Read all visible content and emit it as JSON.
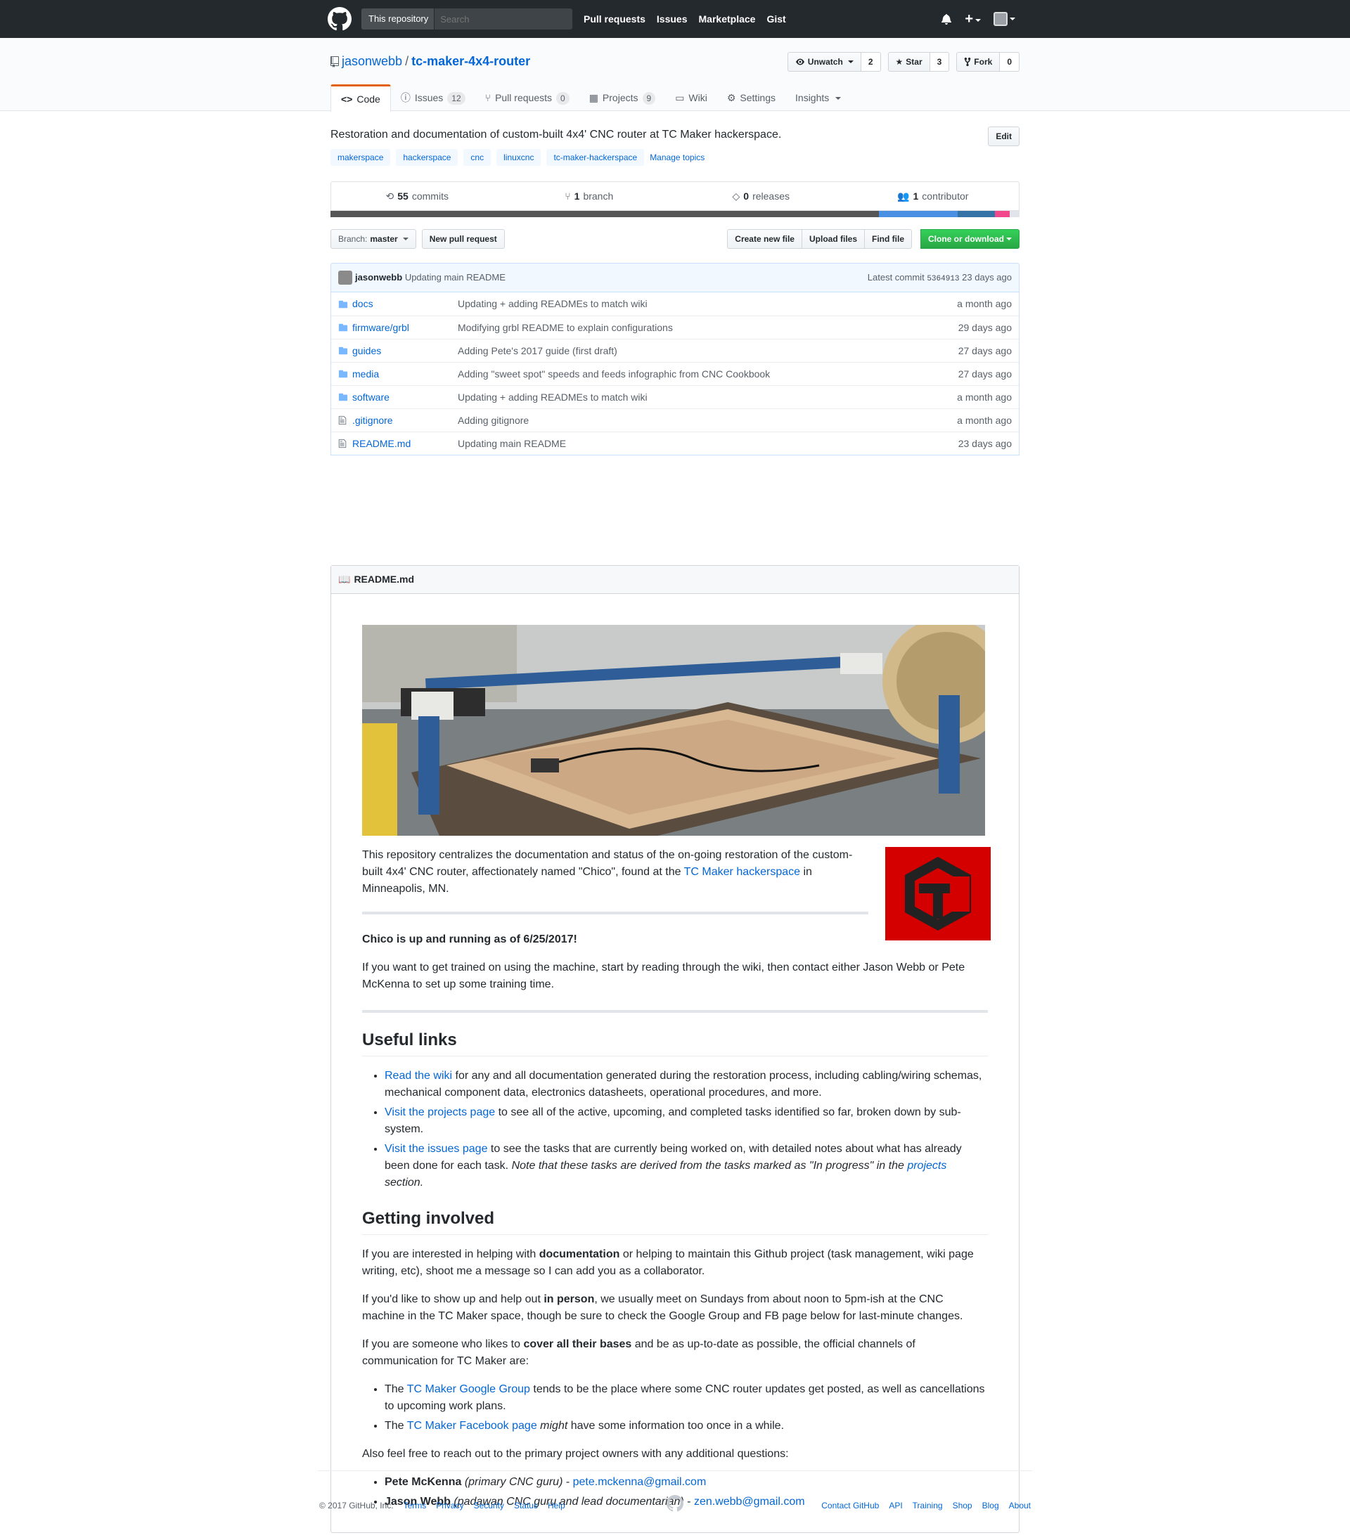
{
  "header": {
    "scope": "This repository",
    "search_placeholder": "Search",
    "nav": [
      "Pull requests",
      "Issues",
      "Marketplace",
      "Gist"
    ],
    "plus": "+"
  },
  "repo": {
    "owner": "jasonwebb",
    "separator": "/",
    "name": "tc-maker-4x4-router",
    "unwatch_label": "Unwatch",
    "watch_count": "2",
    "star_label": "Star",
    "star_count": "3",
    "fork_label": "Fork",
    "fork_count": "0"
  },
  "tabs": [
    {
      "label": "Code",
      "counter": ""
    },
    {
      "label": "Issues",
      "counter": "12"
    },
    {
      "label": "Pull requests",
      "counter": "0"
    },
    {
      "label": "Projects",
      "counter": "9"
    },
    {
      "label": "Wiki",
      "counter": ""
    },
    {
      "label": "Settings",
      "counter": ""
    },
    {
      "label": "Insights",
      "counter": ""
    }
  ],
  "description": "Restoration and documentation of custom-built 4x4' CNC router at TC Maker hackerspace.",
  "edit_label": "Edit",
  "topics": [
    "makerspace",
    "hackerspace",
    "cnc",
    "linuxcnc",
    "tc-maker-hackerspace"
  ],
  "manage_topics": "Manage topics",
  "summary": {
    "commits_num": "55",
    "commits_label": "commits",
    "branch_num": "1",
    "branch_label": "branch",
    "releases_num": "0",
    "releases_label": "releases",
    "contrib_num": "1",
    "contrib_label": "contributor"
  },
  "languages": [
    {
      "color": "#555555",
      "pct": 79.6
    },
    {
      "color": "#4a90e2",
      "pct": 11.4
    },
    {
      "color": "#3572A5",
      "pct": 5.4
    },
    {
      "color": "#f1478b",
      "pct": 2.2
    },
    {
      "color": "#e1e4e8",
      "pct": 1.4
    }
  ],
  "filenav": {
    "branch_prefix": "Branch:",
    "branch": "master",
    "new_pr": "New pull request",
    "create": "Create new file",
    "upload": "Upload files",
    "find": "Find file",
    "clone": "Clone or download"
  },
  "commit": {
    "author": "jasonwebb",
    "message": "Updating main README",
    "latest_label": "Latest commit",
    "sha": "5364913",
    "age": "23 days ago"
  },
  "files": [
    {
      "type": "dir",
      "name": "docs",
      "msg": "Updating + adding READMEs to match wiki",
      "age": "a month ago"
    },
    {
      "type": "dir",
      "name": "firmware/grbl",
      "msg": "Modifying grbl README to explain configurations",
      "age": "29 days ago"
    },
    {
      "type": "dir",
      "name": "guides",
      "msg": "Adding Pete's 2017 guide (first draft)",
      "age": "27 days ago"
    },
    {
      "type": "dir",
      "name": "media",
      "msg": "Adding \"sweet spot\" speeds and feeds infographic from CNC Cookbook",
      "age": "27 days ago"
    },
    {
      "type": "dir",
      "name": "software",
      "msg": "Updating + adding READMEs to match wiki",
      "age": "a month ago"
    },
    {
      "type": "file",
      "name": ".gitignore",
      "msg": "Adding gitignore",
      "age": "a month ago"
    },
    {
      "type": "file",
      "name": "README.md",
      "msg": "Updating main README",
      "age": "23 days ago"
    }
  ],
  "readme": {
    "title": "README.md",
    "intro_a": "This repository centralizes the documentation and status of the on-going restoration of the custom-built 4x4' CNC router, affectionately named \"Chico\", found at the ",
    "intro_link": "TC Maker hackerspace",
    "intro_b": " in Minneapolis, MN.",
    "status": "Chico is up and running as of 6/25/2017!",
    "training": "If you want to get trained on using the machine, start by reading through the wiki, then contact either Jason Webb or Pete McKenna to set up some training time.",
    "h_links": "Useful links",
    "l1_link": "Read the wiki",
    "l1_text": " for any and all documentation generated during the restoration process, including cabling/wiring schemas, mechanical component data, electronics datasheets, operational procedures, and more.",
    "l2_link": "Visit the projects page",
    "l2_text": " to see all of the active, upcoming, and completed tasks identified so far, broken down by sub-system.",
    "l3_link": "Visit the issues page",
    "l3_text": " to see the tasks that are currently being worked on, with detailed notes about what has already been done for each task. ",
    "l3_em_a": "Note that these tasks are derived from the tasks marked as \"In progress\" in the ",
    "l3_em_link": "projects",
    "l3_em_b": " section.",
    "h_involved": "Getting involved",
    "p1_a": "If you are interested in helping with ",
    "p1_b": "documentation",
    "p1_c": " or helping to maintain this Github project (task management, wiki page writing, etc), shoot me a message so I can add you as a collaborator.",
    "p2_a": "If you'd like to show up and help out ",
    "p2_b": "in person",
    "p2_c": ", we usually meet on Sundays from about noon to 5pm-ish at the CNC machine in the TC Maker space, though be sure to check the Google Group and FB page below for last-minute changes.",
    "p3_a": "If you are someone who likes to ",
    "p3_b": "cover all their bases",
    "p3_c": " and be as up-to-date as possible, the official channels of communication for TC Maker are:",
    "c1_a": "The ",
    "c1_link": "TC Maker Google Group",
    "c1_b": " tends to be the place where some CNC router updates get posted, as well as cancellations to upcoming work plans.",
    "c2_a": "The ",
    "c2_link": "TC Maker Facebook page",
    "c2_em": "might",
    "c2_b": " have some information too once in a while.",
    "p4": "Also feel free to reach out to the primary project owners with any additional questions:",
    "o1_name": "Pete McKenna",
    "o1_role": "(primary CNC guru)",
    "o1_dash": " - ",
    "o1_email": "pete.mckenna@gmail.com",
    "o2_name": "Jason Webb",
    "o2_role": "(padawan CNC guru and lead documentarian)",
    "o2_dash": " - ",
    "o2_email": "zen.webb@gmail.com"
  },
  "footer": {
    "copyright": "© 2017 GitHub, Inc.",
    "left_links": [
      "Terms",
      "Privacy",
      "Security",
      "Status",
      "Help"
    ],
    "right_links": [
      "Contact GitHub",
      "API",
      "Training",
      "Shop",
      "Blog",
      "About"
    ]
  }
}
